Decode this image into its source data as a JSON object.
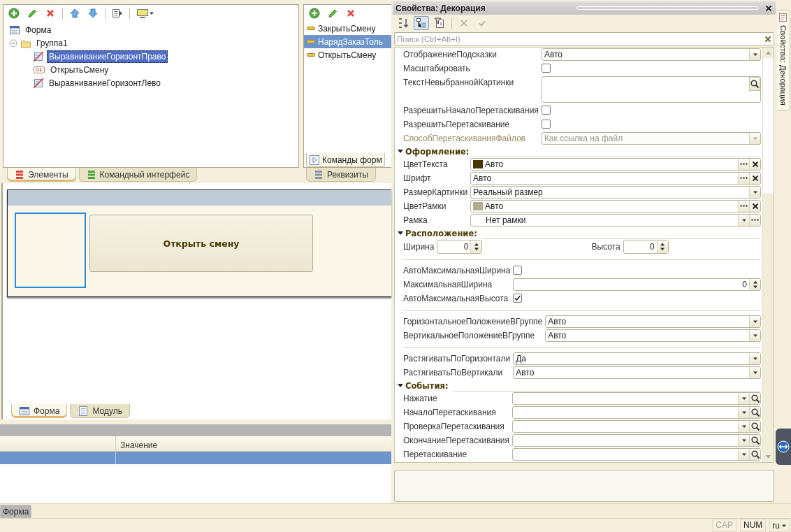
{
  "elements_panel": {
    "tree": [
      {
        "kind": "form",
        "label": "Форма",
        "selected": false,
        "children": [
          {
            "kind": "group",
            "label": "Группа1",
            "selected": false,
            "expanded": true,
            "children": [
              {
                "kind": "decoration",
                "label": "ВыравниваниеГоризонтПраво",
                "selected": true
              },
              {
                "kind": "button",
                "label": "ОткрытьСмену",
                "selected": false
              },
              {
                "kind": "decoration",
                "label": "ВыравниваниеГоризонтЛево",
                "selected": false
              }
            ]
          }
        ]
      }
    ],
    "tabs": [
      {
        "kind": "elements",
        "label": "Элементы",
        "selected": true
      },
      {
        "kind": "commands",
        "label": "Командный интерфейс",
        "selected": false
      }
    ]
  },
  "attributes_panel": {
    "items": [
      {
        "label": "ЗакрытьСмену",
        "selected": false
      },
      {
        "label": "НарядЗаказТоль",
        "selected": true
      },
      {
        "label": "ОткрытьСмену",
        "selected": false
      }
    ],
    "inner_tab": {
      "label": "Команды форм",
      "selected": true
    },
    "tabs": [
      {
        "label": "Реквизиты",
        "selected": false
      }
    ]
  },
  "form_preview": {
    "button": "Открыть смену"
  },
  "editor_tabs": [
    {
      "kind": "form",
      "label": "Форма",
      "selected": true
    },
    {
      "kind": "module",
      "label": "Модуль",
      "selected": false
    }
  ],
  "bottom_panel": {
    "columns": [
      {
        "label": "Значение"
      }
    ],
    "rows": [
      {
        "selected": true
      }
    ]
  },
  "properties": {
    "title": "Свойства: Декорация",
    "search": {
      "placeholder": "Поиск (Ctrl+Alt+I)"
    },
    "groups": [
      {
        "rows": [
          {
            "kind": "dropdown",
            "label": "ОтображениеПодсказки",
            "value": "Авто",
            "disabled": false
          },
          {
            "kind": "checkbox",
            "label": "Масштабировать",
            "checked": false
          },
          {
            "kind": "textarea",
            "label": "ТекстНевыбраннойКартинки"
          },
          {
            "kind": "checkbox",
            "label": "РазрешитьНачалоПеретаскивания",
            "checked": false
          },
          {
            "kind": "checkbox",
            "label": "РазрешитьПеретаскивание",
            "checked": false
          },
          {
            "kind": "dropdown",
            "label": "СпособПеретаскиванияФайлов",
            "value": "Как ссылка на файл",
            "disabled": true
          }
        ]
      },
      {
        "section": {
          "label": "Оформление:",
          "expanded": true
        },
        "rows": [
          {
            "kind": "color",
            "label": "ЦветТекста",
            "value": "Авто",
            "color": "#4a3300"
          },
          {
            "kind": "choice",
            "label": "Шрифт",
            "value": "Авто"
          },
          {
            "kind": "dropdown",
            "label": "РазмерКартинки",
            "value": "Реальный размер",
            "disabled": false
          },
          {
            "kind": "color",
            "label": "ЦветРамки",
            "value": "Авто",
            "color": "#b3ad8e"
          },
          {
            "kind": "dropdown_more",
            "label": "Рамка",
            "value": "Нет рамки"
          }
        ]
      },
      {
        "section": {
          "label": "Расположение:",
          "expanded": true
        },
        "rows": [
          {
            "kind": "size",
            "label": "Ширина",
            "value": "0",
            "label2": "Высота",
            "value2": "0"
          }
        ]
      },
      {
        "rows": [
          {
            "kind": "checkbox",
            "label": "АвтоМаксимальнаяШирина",
            "checked": false
          },
          {
            "kind": "number",
            "label": "МаксимальнаяШирина",
            "value": "0"
          },
          {
            "kind": "checkbox",
            "label": "АвтоМаксимальнаяВысота",
            "checked": true
          }
        ]
      },
      {
        "rows": [
          {
            "kind": "dropdown",
            "label": "ГоризонтальноеПоложениеВГруппе",
            "value": "Авто",
            "disabled": false
          },
          {
            "kind": "dropdown",
            "label": "ВертикальноеПоложениеВГруппе",
            "value": "Авто",
            "disabled": false
          }
        ]
      },
      {
        "rows": [
          {
            "kind": "dropdown",
            "label": "РастягиватьПоГоризонтали",
            "value": "Да",
            "disabled": false
          },
          {
            "kind": "dropdown",
            "label": "РастягиватьПоВертикали",
            "value": "Авто",
            "disabled": false
          }
        ]
      },
      {
        "section": {
          "label": "События:",
          "expanded": true
        },
        "rows": [
          {
            "kind": "event",
            "label": "Нажатие"
          },
          {
            "kind": "event",
            "label": "НачалоПеретаскивания"
          },
          {
            "kind": "event",
            "label": "ПроверкаПеретаскивания"
          },
          {
            "kind": "event",
            "label": "ОкончаниеПеретаскивания"
          },
          {
            "kind": "event",
            "label": "Перетаскивание"
          }
        ]
      }
    ]
  },
  "side_tab": {
    "label": "Свойства: Декорация"
  },
  "taskbar": [
    {
      "label": "Форма",
      "selected": true
    }
  ],
  "status_bar": {
    "indicators": [
      {
        "label": "CAP",
        "on": false
      },
      {
        "label": "NUM",
        "on": true
      }
    ],
    "language": "ru"
  }
}
